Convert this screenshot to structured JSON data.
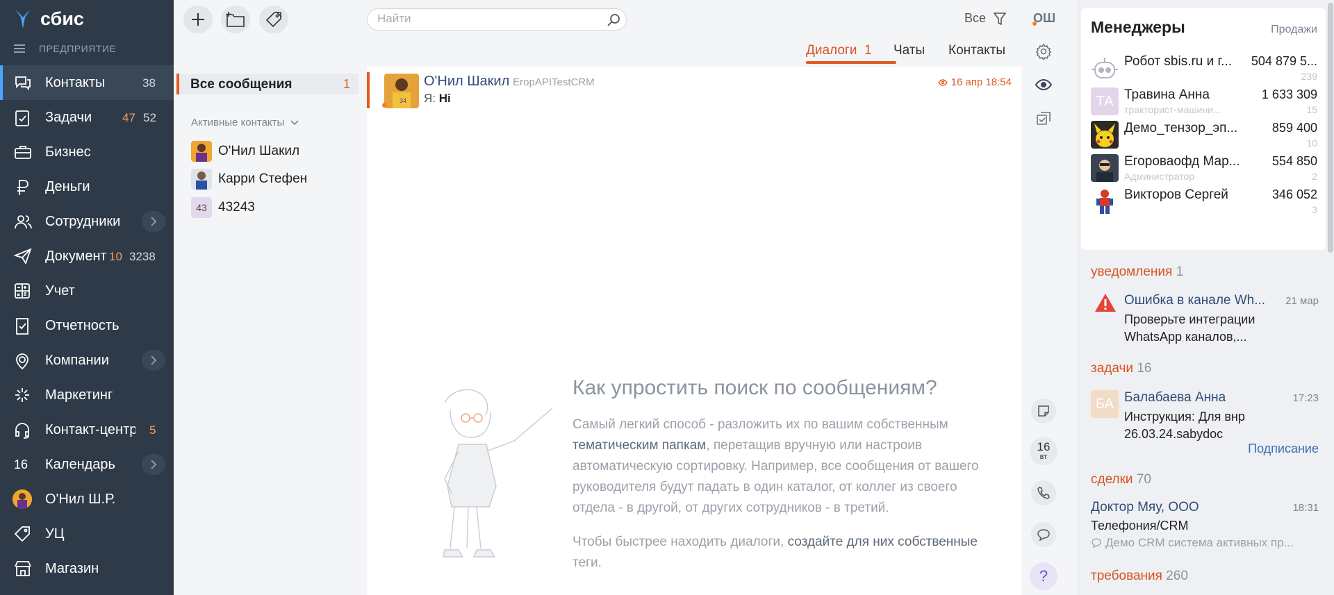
{
  "sidebar": {
    "brand": "сбис",
    "org": "ПРЕДПРИЯТИЕ",
    "items": [
      {
        "label": "Контакты",
        "count1": "38"
      },
      {
        "label": "Задачи",
        "count1": "47",
        "count2": "52"
      },
      {
        "label": "Бизнес"
      },
      {
        "label": "Деньги"
      },
      {
        "label": "Сотрудники"
      },
      {
        "label": "Документы",
        "count1": "10",
        "count2": "3238"
      },
      {
        "label": "Учет"
      },
      {
        "label": "Отчетность"
      },
      {
        "label": "Компании"
      },
      {
        "label": "Маркетинг"
      },
      {
        "label": "Контакт-центр",
        "count1": "5"
      },
      {
        "label": "Календарь",
        "icon_text": "16"
      },
      {
        "label": "О'Нил Ш.Р."
      },
      {
        "label": "УЦ"
      },
      {
        "label": "Магазин"
      }
    ]
  },
  "toolbar": {
    "search_placeholder": "Найти",
    "filter_label": "Все",
    "user_initials": "ОШ"
  },
  "tabs": [
    {
      "label": "Диалоги",
      "count": "1"
    },
    {
      "label": "Чаты"
    },
    {
      "label": "Контакты"
    }
  ],
  "folders": {
    "all_label": "Все сообщения",
    "all_count": "1",
    "active_contacts_header": "Активные контакты",
    "contacts": [
      {
        "name": "О'Нил Шакил"
      },
      {
        "name": "Карри Стефен"
      },
      {
        "name": "43243",
        "initials": "43"
      }
    ]
  },
  "message": {
    "name": "О'Нил Шакил",
    "sub": "ЕгорAPITestCRM",
    "date": "16 апр 18:54",
    "prefix": "Я:",
    "text": "Hi"
  },
  "hint": {
    "title": "Как упростить поиск по сообщениям?",
    "p1_a": "Самый легкий способ - разложить их по вашим собственным ",
    "p1_hl": "тематическим папкам",
    "p1_b": ", перетащив вручную или настроив автоматическую сортировку. Например, все сообщения от вашего руководителя будут падать в один каталог, от коллег из своего отдела - в другой, от других сотрудников - в третий.",
    "p2_a": "Чтобы быстрее находить диалоги, ",
    "p2_hl": "создайте для них собственные",
    "p2_b": " теги."
  },
  "calendar_btn": {
    "day": "16",
    "dow": "вт"
  },
  "managers": {
    "title": "Менеджеры",
    "link": "Продажи",
    "rows": [
      {
        "name": "Робот sbis.ru и г...",
        "sum": "504 879 5...",
        "sub": "",
        "count": "239"
      },
      {
        "name": "Травина Анна",
        "sum": "1 633 309",
        "sub": "тракторист-машини...",
        "count": "15",
        "initials": "ТА"
      },
      {
        "name": "Демо_тензор_эп...",
        "sum": "859 400",
        "sub": "",
        "count": "10"
      },
      {
        "name": "Егороваофд Мар...",
        "sum": "554 850",
        "sub": "Администратор",
        "count": "2"
      },
      {
        "name": "Викторов Сергей",
        "sum": "346 052",
        "sub": "",
        "count": "3"
      }
    ]
  },
  "feed": {
    "notifications": {
      "label": "уведомления",
      "count": "1",
      "title": "Ошибка в канале Wh...",
      "time": "21 мар",
      "text": "Проверьте интеграции WhatsApp каналов,..."
    },
    "tasks": {
      "label": "задачи",
      "count": "16",
      "title": "Балабаева Анна",
      "initials": "БА",
      "time": "17:23",
      "text": "Инструкция: Для внр 26.03.24.sabydoc",
      "link": "Подписание"
    },
    "deals": {
      "label": "сделки",
      "count": "70",
      "title": "Доктор Мяу, ООО",
      "time": "18:31",
      "text": "Телефония/CRM",
      "preview": "Демо CRM система активных пр..."
    },
    "requests": {
      "label": "требования",
      "count": "260"
    }
  }
}
